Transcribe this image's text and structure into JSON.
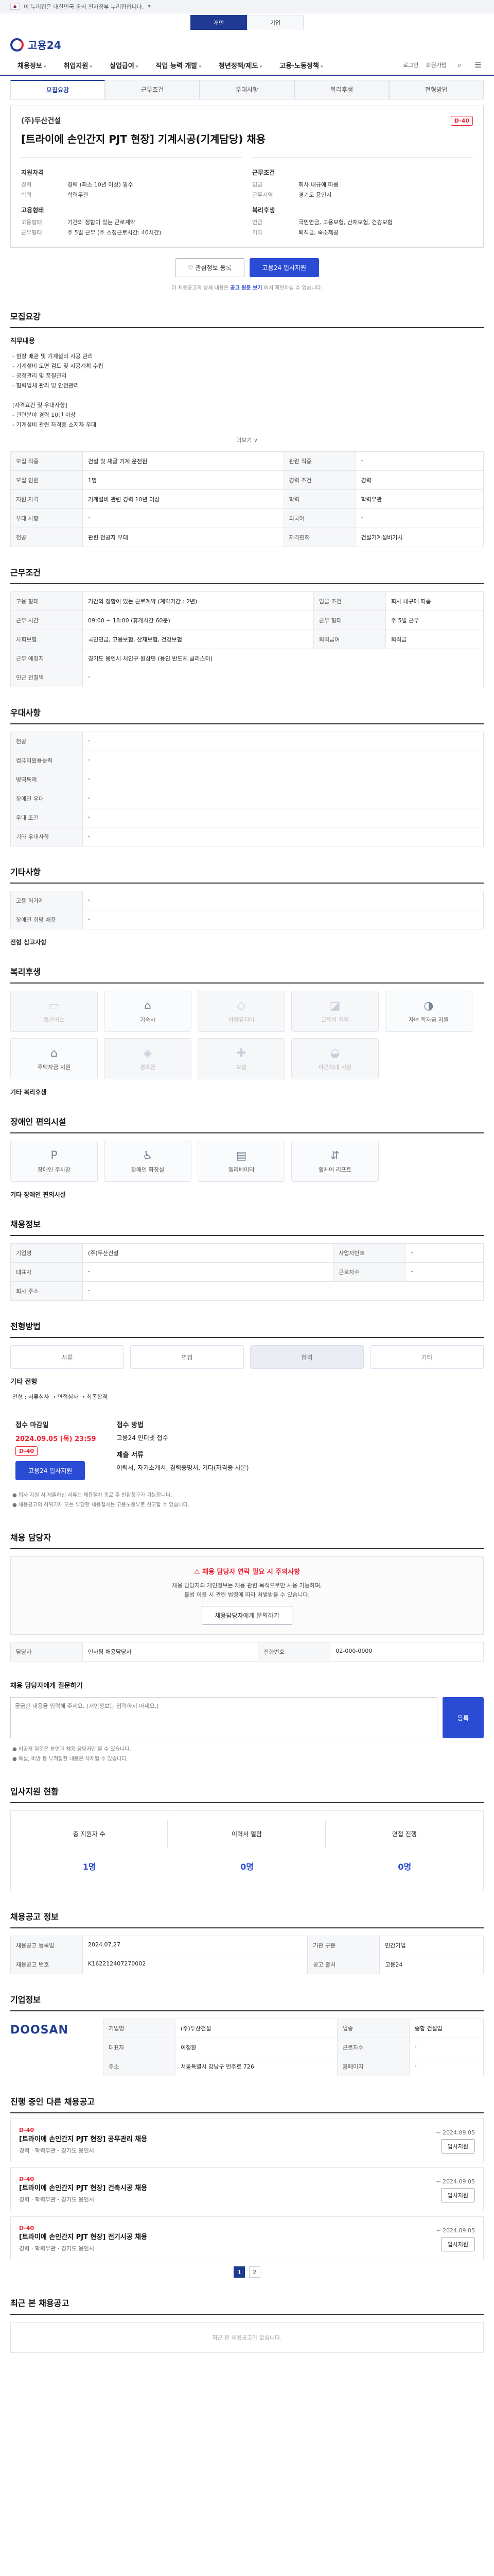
{
  "banner": {
    "text": "이 누리집은 대한민국 공식 전자정부 누리집입니다.",
    "toggle": "▾"
  },
  "util": {
    "tabs": [
      "개인",
      "기업"
    ]
  },
  "app": {
    "logo": "고용24"
  },
  "nav": {
    "items": [
      "채용정보",
      "취업지원",
      "실업급여",
      "직업 능력 개발",
      "청년정책/제도",
      "고용·노동정책"
    ],
    "right": [
      "로그인",
      "회원가입",
      "전체메뉴"
    ]
  },
  "tabs": [
    "모집요강",
    "근무조건",
    "우대사항",
    "복리후생",
    "전형방법"
  ],
  "job": {
    "company": "(주)두산건설",
    "dday": "D-40",
    "title": "[트라이에 손인간지 PJT 현장] 기계시공(기계담당) 채용",
    "left_heading": "지원자격",
    "left": [
      {
        "k": "경력",
        "v": "경력 (최소 10년 이상) 필수"
      },
      {
        "k": "학력",
        "v": "학력무관"
      }
    ],
    "right_heading": "근무조건",
    "right": [
      {
        "k": "임금",
        "v": "회사 내규에 따름"
      },
      {
        "k": "근무지역",
        "v": "경기도 용인시"
      }
    ],
    "left2_heading": "고용형태",
    "left2": [
      {
        "k": "고용형태",
        "v": "기간의 정함이 있는 근로계약"
      },
      {
        "k": "근무형태",
        "v": "주 5일 근무 (주 소정근로시간: 40시간)"
      }
    ],
    "right2_heading": "복리후생",
    "right2": [
      {
        "k": "연금",
        "v": "국민연금, 고용보험, 산재보험, 건강보험"
      },
      {
        "k": "기타",
        "v": "퇴직금, 숙소제공"
      }
    ]
  },
  "buttons": {
    "scrap": "관심정보 등록",
    "apply": "고용24 입사지원"
  },
  "notice": {
    "pre": "이 채용공고의 상세 내용은",
    "link": "공고 원문 보기",
    "post": "에서 확인하실 수 있습니다."
  },
  "sec_recruit": {
    "title": "모집요강",
    "duty_heading": "직무내용",
    "duty": "- 현장 배관 및 기계설비 시공 관리\n- 기계설비 도면 검토 및 시공계획 수립\n- 공정관리 및 품질관리\n- 협력업체 관리 및 안전관리\n\n[자격요건 및 우대사항]\n- 관련분야 경력 10년 이상\n- 기계설비 관련 자격증 소지자 우대",
    "more": "더보기 ∨",
    "rows": [
      {
        "k": "모집 직종",
        "v": "건설 및 채굴 기계 운전원",
        "k2": "관련 직종",
        "v2": "-"
      },
      {
        "k": "모집 인원",
        "v": "1명",
        "k2": "경력 조건",
        "v2": "경력"
      },
      {
        "k": "지원 자격",
        "v": "기계설비 관련 경력 10년 이상",
        "k2": "학력",
        "v2": "학력무관"
      },
      {
        "k": "우대 사항",
        "v": "-",
        "k2": "외국어",
        "v2": "-"
      },
      {
        "k": "전공",
        "v": "관련 전공자 우대",
        "k2": "자격면허",
        "v2": "건설기계설비기사"
      }
    ]
  },
  "sec_work": {
    "title": "근무조건",
    "rows": [
      {
        "k": "고용 형태",
        "v": "기간의 정함이 있는 근로계약 (계약기간 : 2년)",
        "k2": "임금 조건",
        "v2": "회사 내규에 따름"
      },
      {
        "k": "근무 시간",
        "v": "09:00 ~ 18:00 (휴게시간 60분)",
        "k2": "근무 형태",
        "v2": "주 5일 근무"
      },
      {
        "k": "사회보험",
        "v": "국민연금, 고용보험, 산재보험, 건강보험",
        "k2": "퇴직급여",
        "v2": "퇴직금"
      },
      {
        "k": "근무 예정지",
        "v": "경기도 용인시 처인구 원삼면 (용인 반도체 클러스터)",
        "k2": "",
        "v2": ""
      },
      {
        "k": "인근 전철역",
        "v": "-",
        "k2": "",
        "v2": ""
      }
    ]
  },
  "sec_pref": {
    "title": "우대사항",
    "rows": [
      {
        "k": "전공",
        "v": "-"
      },
      {
        "k": "컴퓨터활용능력",
        "v": "-"
      },
      {
        "k": "병역특례",
        "v": "-"
      },
      {
        "k": "장애인 우대",
        "v": "-"
      },
      {
        "k": "우대 조건",
        "v": "-"
      },
      {
        "k": "기타 우대사항",
        "v": "-"
      }
    ]
  },
  "sec_other": {
    "title": "기타사항",
    "rows": [
      {
        "k": "고용 허가제",
        "v": "-"
      },
      {
        "k": "장애인 희망 채용",
        "v": "-"
      }
    ],
    "tail": "전형 참고사항"
  },
  "sec_welfare": {
    "title": "복리후생",
    "icons": [
      {
        "label": "통근버스",
        "sym": "▭",
        "on": false
      },
      {
        "label": "기숙사",
        "sym": "⌂",
        "on": true
      },
      {
        "label": "차량유지비",
        "sym": "◇",
        "on": false
      },
      {
        "label": "교육비 지원",
        "sym": "◪",
        "on": false
      },
      {
        "label": "자녀 학자금 지원",
        "sym": "◑",
        "on": true
      },
      {
        "label": "주택자금 지원",
        "sym": "⌂",
        "on": true
      },
      {
        "label": "경조금",
        "sym": "◈",
        "on": false
      },
      {
        "label": "보험",
        "sym": "✚",
        "on": false
      },
      {
        "label": "야근식대 지원",
        "sym": "◒",
        "on": false
      }
    ],
    "extra": "기타 복리후생"
  },
  "sec_disabled": {
    "title": "장애인 편의시설",
    "icons": [
      {
        "label": "장애인 주차장",
        "sym": "P"
      },
      {
        "label": "장애인 화장실",
        "sym": "♿"
      },
      {
        "label": "엘리베이터",
        "sym": "▤"
      },
      {
        "label": "휠체어 리프트",
        "sym": "⇵"
      }
    ],
    "extra": "기타 장애인 편의시설"
  },
  "sec_company_info": {
    "title": "채용정보",
    "rows": [
      {
        "k": "기업명",
        "v": "(주)두산건설",
        "k2": "사업자번호",
        "v2": "-"
      },
      {
        "k": "대표자",
        "v": "-",
        "k2": "근로자수",
        "v2": "-"
      },
      {
        "k": "회사 주소",
        "v": "-",
        "k2": "",
        "v2": ""
      }
    ]
  },
  "sec_process": {
    "title": "전형방법",
    "steps": [
      "서류",
      "면접",
      "합격",
      "기타"
    ],
    "active": 2,
    "desc_heading": "기타 전형",
    "desc": "전형 : 서류심사 → 면접심사 → 최종합격",
    "deadline_label": "접수 마감일",
    "deadline": "2024.09.05 (목) 23:59",
    "deadline_d": "D-40",
    "method_label": "접수 방법",
    "method": "고용24 인터넷 접수",
    "docs_label": "제출 서류",
    "docs": "이력서, 자기소개서, 경력증명서, 기타(자격증 사본)",
    "apply": "고용24 입사지원",
    "notes": "● 입사 지원 시 제출하신 서류는 채용절차 종료 후 반환청구가 가능합니다.\n● 채용공고의 허위기재 또는 부당한 채용절차는 고용노동부로 신고할 수 있습니다."
  },
  "sec_contact": {
    "title": "채용 담당자",
    "rows": [
      {
        "k": "담당자",
        "v": "인사팀 채용담당자",
        "k2": "전화번호",
        "v2": "02-000-0000"
      }
    ]
  },
  "sec_warn": {
    "w1": "채용 담당자 연락 필요 시 주의사항",
    "p": "채용 담당자의 개인정보는 채용 관련 목적으로만 사용 가능하며,\n불법 이용 시 관련 법령에 따라 처벌받을 수 있습니다.",
    "btn": "채용담당자에게 문의하기"
  },
  "sec_qa": {
    "title": "채용 담당자에게 질문하기",
    "placeholder": "궁금한 내용을 입력해 주세요. (개인정보는 입력하지 마세요.)",
    "send": "등록",
    "notes": "● 비공개 질문은 본인과 채용 담당자만 볼 수 있습니다.\n● 욕설, 비방 등 부적절한 내용은 삭제될 수 있습니다."
  },
  "sec_stats": {
    "title": "입사지원 현황",
    "items": [
      {
        "k": "총 지원자 수",
        "v": "1명"
      },
      {
        "k": "이력서 열람",
        "v": "0명"
      },
      {
        "k": "면접 진행",
        "v": "0명"
      }
    ]
  },
  "sec_summary": {
    "title": "채용공고 정보",
    "rows": [
      {
        "k": "채용공고 등록일",
        "v": "2024.07.27",
        "k2": "기관 구분",
        "v2": "민간기업"
      },
      {
        "k": "채용공고 번호",
        "v": "K162212407270002",
        "k2": "공고 출처",
        "v2": "고용24"
      }
    ]
  },
  "sec_corp": {
    "title": "기업정보",
    "brand": "DOOSAN",
    "rows": [
      {
        "k": "기업명",
        "v": "(주)두산건설",
        "k2": "업종",
        "v2": "종합 건설업"
      },
      {
        "k": "대표자",
        "v": "이정환",
        "k2": "근로자수",
        "v2": "-"
      },
      {
        "k": "주소",
        "v": "서울특별시 강남구 언주로 726",
        "k2": "홈페이지",
        "v2": "-"
      }
    ]
  },
  "sec_list": {
    "title": "진행 중인 다른 채용공고",
    "items": [
      {
        "dd": "D-40",
        "title": "[트라이에 손인간지 PJT 현장] 공무관리 채용",
        "meta": "경력 · 학력무관 · 경기도 용인시",
        "right": "~ 2024.09.05",
        "btn": "입사지원"
      },
      {
        "dd": "D-40",
        "title": "[트라이에 손인간지 PJT 현장] 건축시공 채용",
        "meta": "경력 · 학력무관 · 경기도 용인시",
        "right": "~ 2024.09.05",
        "btn": "입사지원"
      },
      {
        "dd": "D-40",
        "title": "[트라이에 손인간지 PJT 현장] 전기시공 채용",
        "meta": "경력 · 학력무관 · 경기도 용인시",
        "right": "~ 2024.09.05",
        "btn": "입사지원"
      }
    ],
    "pages": [
      "1",
      "2"
    ]
  },
  "sec_recent": {
    "title": "최근 본 채용공고",
    "empty": "최근 본 채용공고가 없습니다."
  }
}
